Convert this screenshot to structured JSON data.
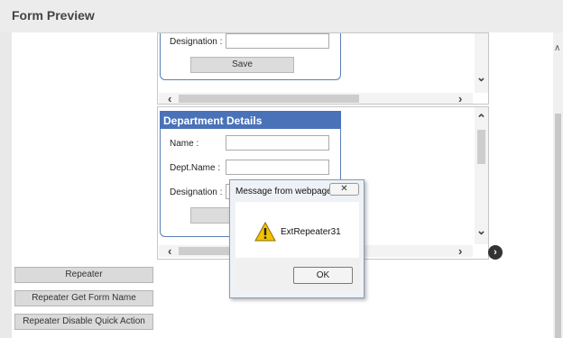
{
  "header": {
    "title": "Form Preview"
  },
  "form1": {
    "designation_label": "Designation :",
    "save_label": "Save"
  },
  "form2": {
    "title": "Department Details",
    "name_label": "Name :",
    "dept_label": "Dept.Name :",
    "designation_label": "Designation :"
  },
  "side_buttons": [
    {
      "label": "Repeater"
    },
    {
      "label": "Repeater Get Form Name"
    },
    {
      "label": "Repeater Disable Quick Action"
    }
  ],
  "dialog": {
    "title": "Message from webpage",
    "close_glyph": "✕",
    "message": "ExtRepeater31",
    "ok_label": "OK"
  },
  "icons": {
    "left": "chevron-left-icon",
    "right": "chevron-right-icon",
    "up": "chevron-up-icon",
    "down": "chevron-down-icon",
    "next": "circle-arrow-right-icon",
    "warning": "warning-icon"
  },
  "colors": {
    "panel_header": "#4a72b8",
    "panel_border": "#5b7fb8",
    "warning": "#f2c200"
  }
}
